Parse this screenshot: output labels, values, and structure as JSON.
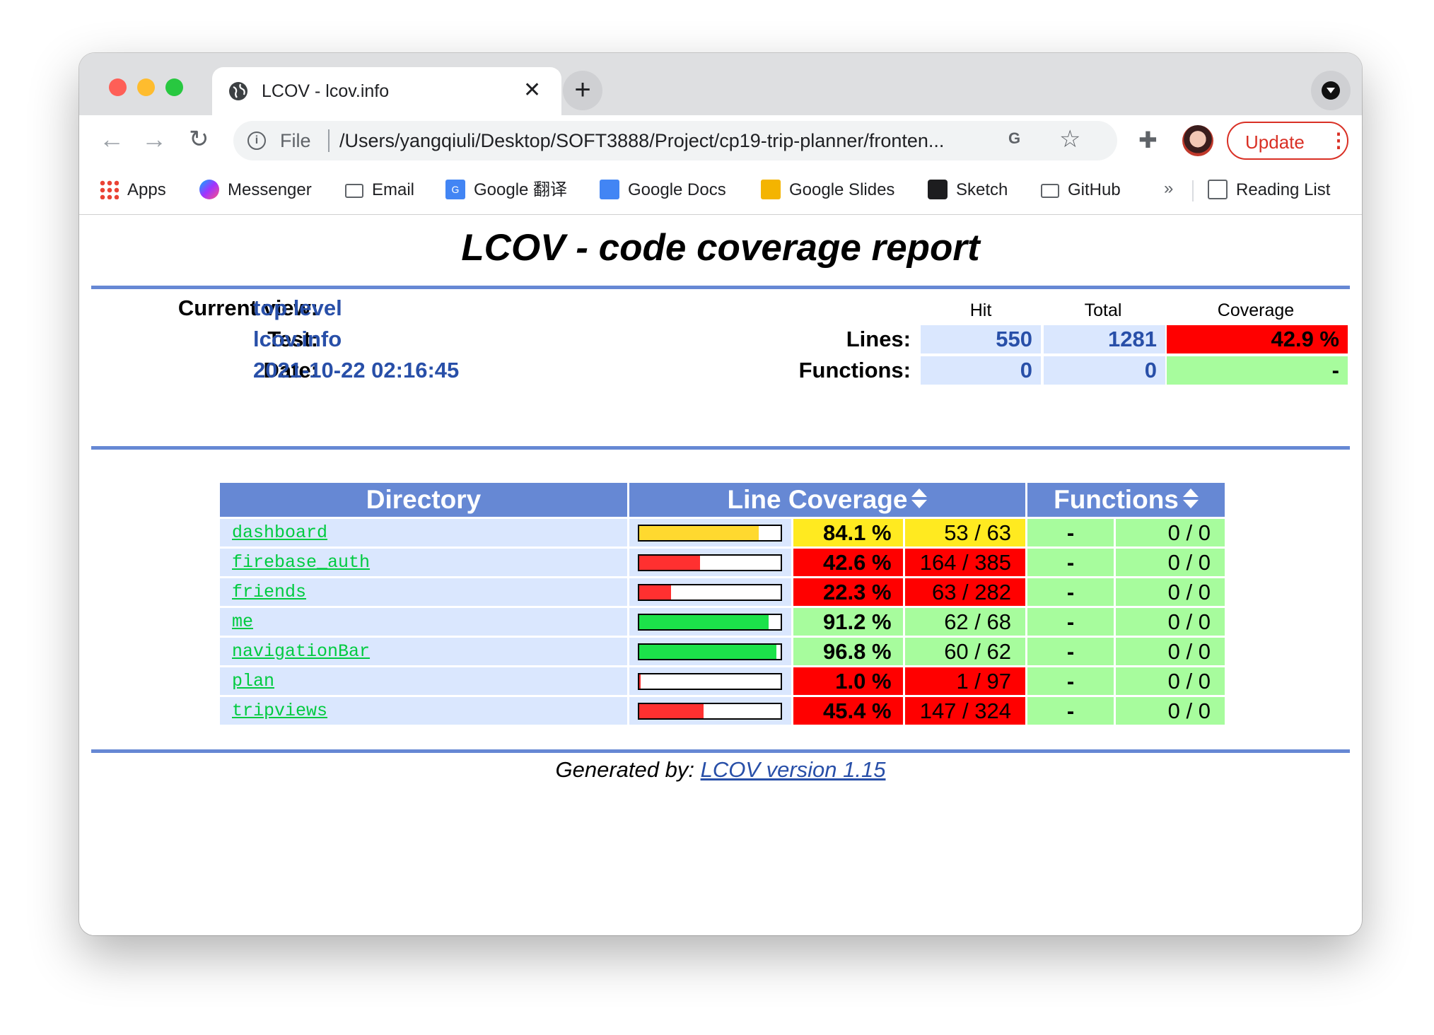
{
  "browser": {
    "tab_title": "LCOV - lcov.info",
    "tab_close": "✕",
    "new_tab": "+",
    "omnibox_scheme": "File",
    "omnibox_url": "/Users/yangqiuli/Desktop/SOFT3888/Project/cp19-trip-planner/fronten...",
    "update_label": "Update",
    "bookmarks": [
      {
        "label": "Apps",
        "icon": "apps-grid-icon"
      },
      {
        "label": "Messenger",
        "icon": "messenger-icon"
      },
      {
        "label": "Email",
        "icon": "folder-icon"
      },
      {
        "label": "Google 翻译",
        "icon": "google-translate-icon"
      },
      {
        "label": "Google Docs",
        "icon": "google-docs-icon"
      },
      {
        "label": "Google Slides",
        "icon": "google-slides-icon"
      },
      {
        "label": "Sketch",
        "icon": "sketch-icon"
      },
      {
        "label": "GitHub",
        "icon": "folder-icon"
      }
    ],
    "bookmarks_overflow": "»",
    "reading_list": "Reading List"
  },
  "report": {
    "title": "LCOV - code coverage report",
    "current_view_label": "Current view:",
    "current_view_value": "top level",
    "test_label": "Test:",
    "test_value": "lcov.info",
    "date_label": "Date:",
    "date_value": "2021-10-22 02:16:45",
    "summary_headers": {
      "hit": "Hit",
      "total": "Total",
      "coverage": "Coverage"
    },
    "lines": {
      "label": "Lines:",
      "hit": "550",
      "total": "1281",
      "coverage": "42.9 %"
    },
    "functions": {
      "label": "Functions:",
      "hit": "0",
      "total": "0",
      "coverage": "-"
    },
    "table_headers": {
      "directory": "Directory",
      "line_coverage": "Line Coverage",
      "functions": "Functions"
    },
    "rows": [
      {
        "name": "dashboard",
        "bar_pct": 84.1,
        "pct": "84.1 %",
        "lines": "53 / 63",
        "level": "med",
        "fpct": "-",
        "fcount": "0 / 0"
      },
      {
        "name": "firebase_auth",
        "bar_pct": 42.6,
        "pct": "42.6 %",
        "lines": "164 / 385",
        "level": "lo",
        "fpct": "-",
        "fcount": "0 / 0"
      },
      {
        "name": "friends",
        "bar_pct": 22.3,
        "pct": "22.3 %",
        "lines": "63 / 282",
        "level": "lo",
        "fpct": "-",
        "fcount": "0 / 0"
      },
      {
        "name": "me",
        "bar_pct": 91.2,
        "pct": "91.2 %",
        "lines": "62 / 68",
        "level": "hi",
        "fpct": "-",
        "fcount": "0 / 0"
      },
      {
        "name": "navigationBar",
        "bar_pct": 96.8,
        "pct": "96.8 %",
        "lines": "60 / 62",
        "level": "hi",
        "fpct": "-",
        "fcount": "0 / 0"
      },
      {
        "name": "plan",
        "bar_pct": 1.0,
        "pct": "1.0 %",
        "lines": "1 / 97",
        "level": "lo",
        "fpct": "-",
        "fcount": "0 / 0"
      },
      {
        "name": "tripviews",
        "bar_pct": 45.4,
        "pct": "45.4 %",
        "lines": "147 / 324",
        "level": "lo",
        "fpct": "-",
        "fcount": "0 / 0"
      }
    ],
    "footer_prefix": "Generated by: ",
    "footer_link": "LCOV version 1.15"
  },
  "colors": {
    "ruler": "#6688d4",
    "hi_cell": "#a7fc9d",
    "med_cell": "#ffea20",
    "lo_cell": "#ff0000",
    "hi_bar": "#1ce24a",
    "med_bar": "#ffd92f",
    "lo_bar": "#ff3030"
  }
}
